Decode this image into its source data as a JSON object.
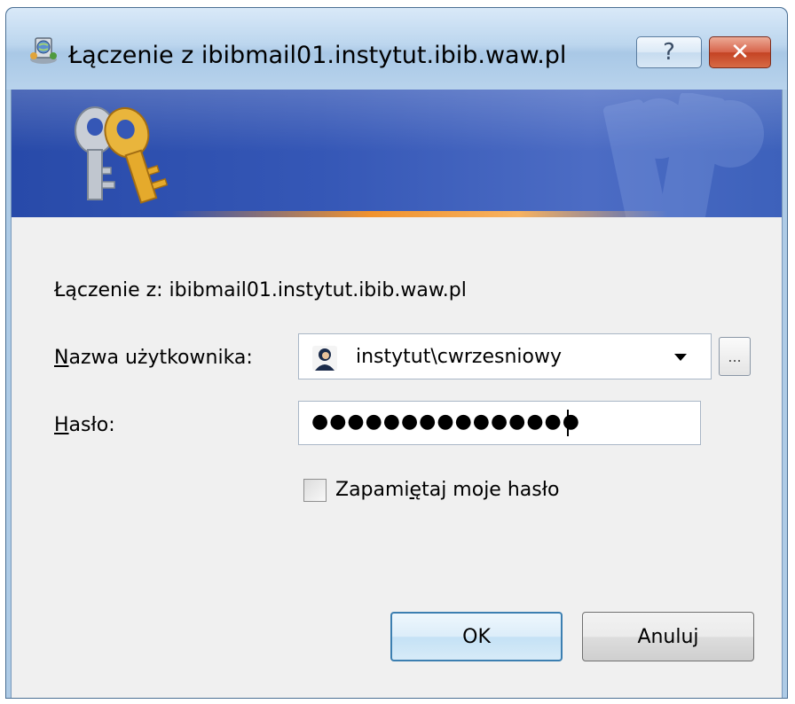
{
  "window": {
    "title": "Łączenie z ibibmail01.instytut.ibib.waw.pl",
    "help_label": "?",
    "close_label": "✕"
  },
  "dialog": {
    "connecting_text": "Łączenie z: ibibmail01.instytut.ibib.waw.pl",
    "username": {
      "label_accel": "N",
      "label_rest": "azwa użytkownika:",
      "value": "instytut\\cwrzesniowy",
      "browse_label": "..."
    },
    "password": {
      "label_accel": "H",
      "label_rest": "asło:",
      "masked_value": "●●●●●●●●●●●●●●●"
    },
    "remember": {
      "label_pre": "Zapami",
      "label_accel": "ę",
      "label_post": "taj moje hasło",
      "checked": false
    },
    "buttons": {
      "ok_label": "OK",
      "cancel_label": "Anuluj"
    }
  },
  "icons": {
    "app": "network-globe-icon",
    "banner": "keys-icon",
    "user": "user-icon",
    "dropdown": "chevron-down-icon"
  },
  "colors": {
    "banner_blue": "#3557b6",
    "banner_accent_orange": "#f0922d",
    "close_red": "#c44323",
    "focus_blue": "#3c7fb1"
  }
}
